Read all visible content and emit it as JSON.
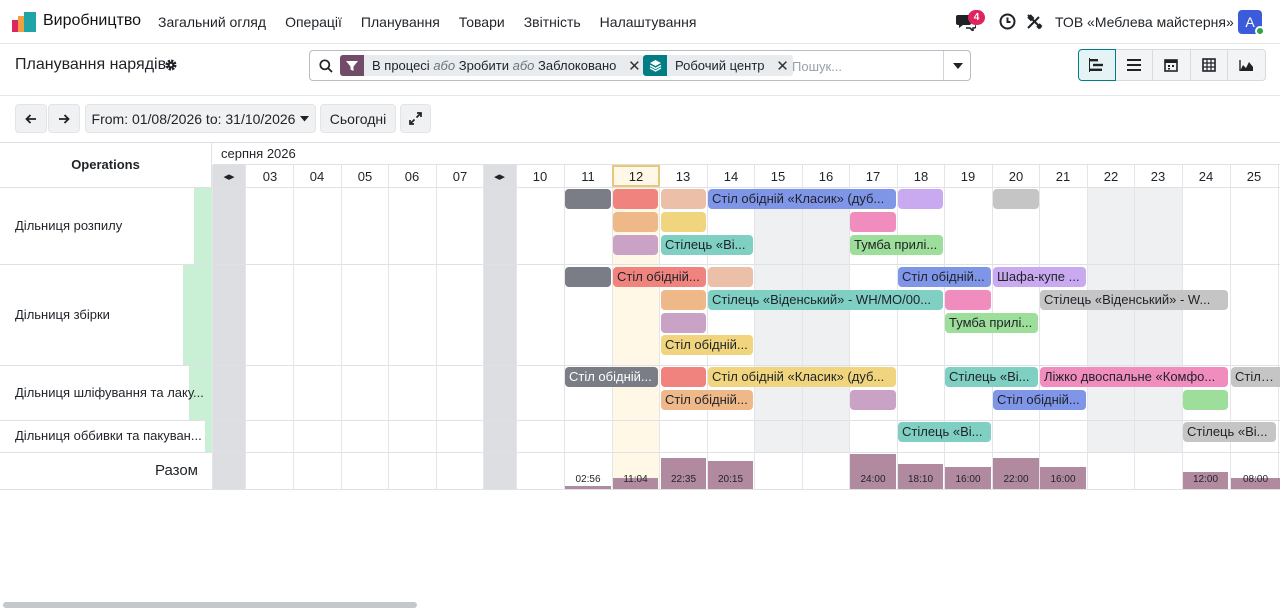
{
  "app": {
    "name": "Виробництво"
  },
  "menu": [
    "Загальний огляд",
    "Операції",
    "Планування",
    "Товари",
    "Звітність",
    "Налаштування"
  ],
  "systray": {
    "messages_count": "4",
    "company": "ТОВ «Меблева майстерня»",
    "avatar_letter": "A"
  },
  "page": {
    "title": "Планування нарядів"
  },
  "search": {
    "facet_state": {
      "v1": "В процесі",
      "or": "або",
      "v2": "Зробити",
      "v3": "Заблоковано"
    },
    "facet_group": "Робочий центр",
    "placeholder": "Пошук..."
  },
  "toolbar": {
    "range": "From: 01/08/2026 to: 31/10/2026",
    "today": "Сьогодні"
  },
  "gantt": {
    "ops_header": "Operations",
    "month": "серпня 2026",
    "collapse_glyph": "◂▸",
    "days": [
      "03",
      "04",
      "05",
      "06",
      "07",
      "10",
      "11",
      "12",
      "13",
      "14",
      "15",
      "16",
      "17",
      "18",
      "19",
      "20",
      "21",
      "22",
      "23",
      "24",
      "25"
    ],
    "rows": [
      "Дільниця розпилу",
      "Дільниця збірки",
      "Дільниця шліфування та лаку...",
      "Дільниця оббивки та пакуван..."
    ],
    "total_label": "Разом",
    "pills": [
      "Стіл обідній «Класик» (дуб...",
      "Стілець «Ві...",
      "Тумба прилі...",
      "Стіл обідній...",
      "Стіл обідній...",
      "Шафа-купе ...",
      "Стілець «Віденський» - WH/MO/00...",
      "Стілець «Віденський» - W...",
      "Тумба прилі...",
      "Стіл обідній...",
      "Стіл обідній...",
      "Стіл обідній «Класик» (дуб...",
      "Стілець «Ві...",
      "Ліжко двоспальне «Комфо...",
      "Стілець...",
      "Стіл обідній...",
      "Стіл обідній...",
      "Стілець «Ві...",
      "Стілець «Ві..."
    ],
    "totals": [
      "02:56",
      "11:04",
      "22:35",
      "20:15",
      "24:00",
      "18:10",
      "16:00",
      "22:00",
      "16:00",
      "12:00",
      "08:00"
    ]
  }
}
